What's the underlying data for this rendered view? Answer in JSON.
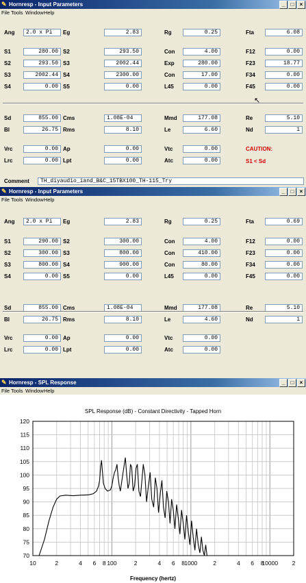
{
  "window1": {
    "title": "Hornresp - Input Parameters",
    "menu": [
      "File",
      "Tools",
      "Window",
      "Help"
    ],
    "rows": [
      {
        "cells": [
          {
            "label": "Ang",
            "value": "2.0 x Pi",
            "align": "left"
          },
          {
            "label": "Eg",
            "value": "2.83"
          },
          {
            "label": "Rg",
            "value": "0.25"
          },
          {
            "label": "Fta",
            "value": "6.08"
          }
        ]
      },
      {
        "cells": [
          {
            "label": "S1",
            "value": "280.00"
          },
          {
            "label": "S2",
            "value": "293.50"
          },
          {
            "label": "Con",
            "value": "4.00"
          },
          {
            "label": "F12",
            "value": "0.00"
          }
        ]
      },
      {
        "cells": [
          {
            "label": "S2",
            "value": "293.50"
          },
          {
            "label": "S3",
            "value": "2002.44"
          },
          {
            "label": "Exp",
            "value": "280.00"
          },
          {
            "label": "F23",
            "value": "18.77"
          }
        ]
      },
      {
        "cells": [
          {
            "label": "S3",
            "value": "2002.44"
          },
          {
            "label": "S4",
            "value": "2300.00"
          },
          {
            "label": "Con",
            "value": "17.00"
          },
          {
            "label": "F34",
            "value": "0.00"
          }
        ]
      },
      {
        "cells": [
          {
            "label": "S4",
            "value": "0.00"
          },
          {
            "label": "S5",
            "value": "0.00"
          },
          {
            "label": "L45",
            "value": "0.00"
          },
          {
            "label": "F45",
            "value": "0.00"
          }
        ]
      },
      {
        "cells": [
          {
            "label": "Sd",
            "value": "855.00"
          },
          {
            "label": "Cms",
            "value": "1.08E-04",
            "align": "left"
          },
          {
            "label": "Mmd",
            "value": "177.08"
          },
          {
            "label": "Re",
            "value": "5.10"
          }
        ]
      },
      {
        "cells": [
          {
            "label": "Bl",
            "value": "26.75"
          },
          {
            "label": "Rms",
            "value": "8.10"
          },
          {
            "label": "Le",
            "value": "6.60"
          },
          {
            "label": "Nd",
            "value": "1"
          }
        ]
      },
      {
        "cells": [
          {
            "label": "Vrc",
            "value": "0.00"
          },
          {
            "label": "Ap",
            "value": "0.00"
          },
          {
            "label": "Vtc",
            "value": "0.00"
          }
        ]
      },
      {
        "cells": [
          {
            "label": "Lrc",
            "value": "0.00"
          },
          {
            "label": "Lpt",
            "value": "0.00"
          },
          {
            "label": "Atc",
            "value": "0.00"
          }
        ]
      }
    ],
    "caution_title": "CAUTION:",
    "caution_text": "S1 < Sd",
    "comment_label": "Comment",
    "comment_value": "TH_diyaudio_iand_B&C_15TBX100_TH-115_Try"
  },
  "window2": {
    "title": "Hornresp - Input Parameters",
    "menu": [
      "File",
      "Tools",
      "Window",
      "Help"
    ],
    "rows": [
      {
        "cells": [
          {
            "label": "Ang",
            "value": "2.0 x Pi",
            "align": "left"
          },
          {
            "label": "Eg",
            "value": "2.83"
          },
          {
            "label": "Rg",
            "value": "0.25"
          },
          {
            "label": "Fta",
            "value": "0.69"
          }
        ]
      },
      {
        "cells": [
          {
            "label": "S1",
            "value": "290.00"
          },
          {
            "label": "S2",
            "value": "300.00"
          },
          {
            "label": "Con",
            "value": "4.00"
          },
          {
            "label": "F12",
            "value": "0.00"
          }
        ]
      },
      {
        "cells": [
          {
            "label": "S2",
            "value": "300.00"
          },
          {
            "label": "S3",
            "value": "800.00"
          },
          {
            "label": "Con",
            "value": "410.00"
          },
          {
            "label": "F23",
            "value": "0.00"
          }
        ]
      },
      {
        "cells": [
          {
            "label": "S3",
            "value": "800.00"
          },
          {
            "label": "S4",
            "value": "900.00"
          },
          {
            "label": "Con",
            "value": "80.00"
          },
          {
            "label": "F34",
            "value": "0.00"
          }
        ]
      },
      {
        "cells": [
          {
            "label": "S4",
            "value": "0.00"
          },
          {
            "label": "S5",
            "value": "0.00"
          },
          {
            "label": "L45",
            "value": "0.00"
          },
          {
            "label": "F45",
            "value": "0.00"
          }
        ]
      },
      {
        "cells": [
          {
            "label": "Sd",
            "value": "855.00"
          },
          {
            "label": "Cms",
            "value": "1.08E-04",
            "align": "left"
          },
          {
            "label": "Mmd",
            "value": "177.08"
          },
          {
            "label": "Re",
            "value": "5.10"
          }
        ]
      },
      {
        "cells": [
          {
            "label": "Bl",
            "value": "26.75"
          },
          {
            "label": "Rms",
            "value": "8.10"
          },
          {
            "label": "Le",
            "value": "4.60"
          },
          {
            "label": "Nd",
            "value": "1"
          }
        ]
      },
      {
        "cells": [
          {
            "label": "Vrc",
            "value": "0.00"
          },
          {
            "label": "Ap",
            "value": "0.00"
          },
          {
            "label": "Vtc",
            "value": "0.00"
          }
        ]
      },
      {
        "cells": [
          {
            "label": "Lrc",
            "value": "0.00"
          },
          {
            "label": "Lpt",
            "value": "0.00"
          },
          {
            "label": "Atc",
            "value": "0.00"
          }
        ]
      }
    ]
  },
  "window3": {
    "title": "Hornresp - SPL Response",
    "menu": [
      "File",
      "Tools",
      "Window",
      "Help"
    ]
  },
  "chart_data": {
    "type": "line",
    "title": "SPL Response (dB) - Constant Directivity - Tapped Horn",
    "xlabel": "Frequency (hertz)",
    "ylabel": "",
    "x_scale": "log",
    "xlim": [
      10,
      20000
    ],
    "ylim": [
      70,
      120
    ],
    "grid": true,
    "y_ticks": [
      "120",
      "115",
      "110",
      "105",
      "100",
      "95",
      "90",
      "85",
      "80",
      "75",
      "70"
    ],
    "x_ticks": [
      {
        "value": 10,
        "label": "10"
      },
      {
        "value": 20,
        "label": "2"
      },
      {
        "value": 40,
        "label": "4"
      },
      {
        "value": 60,
        "label": "6"
      },
      {
        "value": 80,
        "label": "8"
      },
      {
        "value": 100,
        "label": "100"
      },
      {
        "value": 200,
        "label": "2"
      },
      {
        "value": 400,
        "label": "4"
      },
      {
        "value": 600,
        "label": "6"
      },
      {
        "value": 800,
        "label": "8"
      },
      {
        "value": 1000,
        "label": "1000"
      },
      {
        "value": 2000,
        "label": "2"
      },
      {
        "value": 4000,
        "label": "4"
      },
      {
        "value": 6000,
        "label": "6"
      },
      {
        "value": 8000,
        "label": "8"
      },
      {
        "value": 10000,
        "label": "10000"
      },
      {
        "value": 20000,
        "label": "2"
      }
    ],
    "series": [
      {
        "values": [
          [
            12,
            70
          ],
          [
            14,
            76
          ],
          [
            16,
            83
          ],
          [
            18,
            88
          ],
          [
            20,
            91
          ],
          [
            22,
            92.2
          ],
          [
            26,
            92.5
          ],
          [
            32,
            92.3
          ],
          [
            40,
            92.5
          ],
          [
            50,
            92.6
          ],
          [
            58,
            93
          ],
          [
            64,
            94
          ],
          [
            68,
            96
          ],
          [
            70,
            98
          ],
          [
            72,
            103
          ],
          [
            74,
            105.5
          ],
          [
            76,
            101
          ],
          [
            78,
            97
          ],
          [
            82,
            95
          ],
          [
            88,
            94
          ],
          [
            96,
            94.5
          ],
          [
            100,
            96
          ],
          [
            104,
            99
          ],
          [
            108,
            101
          ],
          [
            112,
            102
          ],
          [
            116,
            104
          ],
          [
            120,
            99
          ],
          [
            124,
            96
          ],
          [
            128,
            94
          ],
          [
            134,
            98
          ],
          [
            142,
            103
          ],
          [
            148,
            106.5
          ],
          [
            154,
            100
          ],
          [
            160,
            95
          ],
          [
            166,
            97
          ],
          [
            172,
            104
          ],
          [
            178,
            103
          ],
          [
            186,
            94
          ],
          [
            194,
            96
          ],
          [
            202,
            102.5
          ],
          [
            210,
            104
          ],
          [
            220,
            94
          ],
          [
            230,
            92
          ],
          [
            240,
            98
          ],
          [
            250,
            104
          ],
          [
            262,
            100
          ],
          [
            275,
            90
          ],
          [
            290,
            96
          ],
          [
            305,
            101
          ],
          [
            320,
            91
          ],
          [
            338,
            88
          ],
          [
            355,
            99
          ],
          [
            372,
            95
          ],
          [
            390,
            86
          ],
          [
            410,
            93
          ],
          [
            430,
            98
          ],
          [
            450,
            88
          ],
          [
            472,
            84
          ],
          [
            495,
            94
          ],
          [
            520,
            90
          ],
          [
            545,
            82
          ],
          [
            570,
            91
          ],
          [
            598,
            87
          ],
          [
            628,
            80
          ],
          [
            660,
            89
          ],
          [
            692,
            84
          ],
          [
            726,
            78
          ],
          [
            762,
            87
          ],
          [
            800,
            82
          ],
          [
            840,
            76
          ],
          [
            882,
            85
          ],
          [
            926,
            79
          ],
          [
            972,
            74
          ],
          [
            1020,
            83
          ],
          [
            1070,
            77
          ],
          [
            1125,
            72
          ],
          [
            1180,
            80
          ],
          [
            1240,
            74
          ],
          [
            1300,
            71
          ],
          [
            1360,
            77
          ],
          [
            1420,
            72
          ],
          [
            1480,
            70
          ],
          [
            1540,
            74
          ],
          [
            1600,
            70
          ]
        ]
      }
    ]
  }
}
